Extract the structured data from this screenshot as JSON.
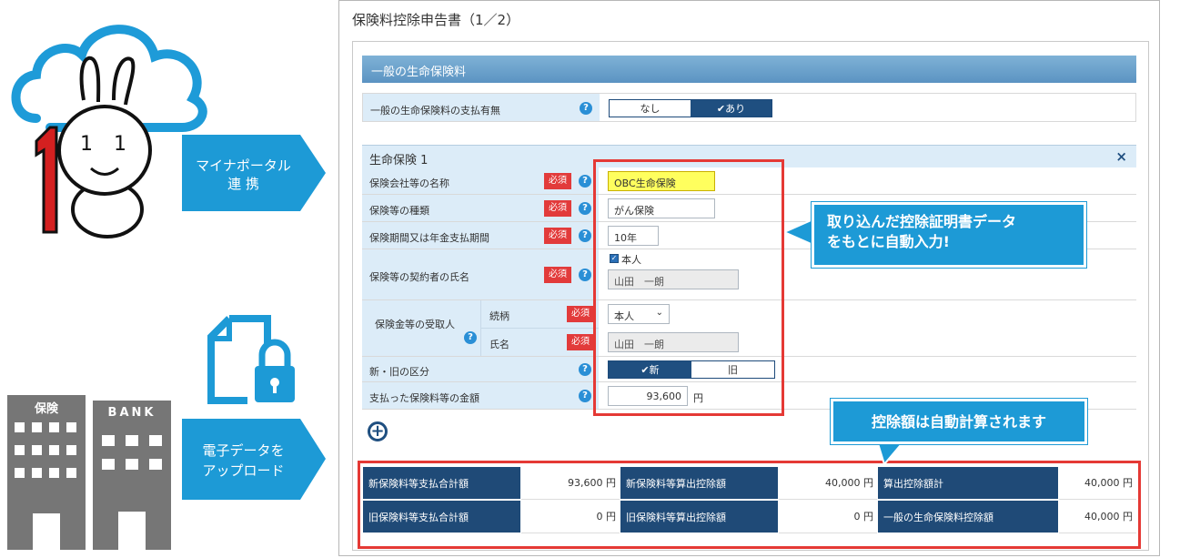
{
  "left": {
    "arrow_top": {
      "line1": "マイナポータル",
      "line2": "連 携"
    },
    "arrow_bottom": {
      "line1": "電子データを",
      "line2": "アップロード"
    },
    "building_insurance": "保険",
    "building_bank": "BANK"
  },
  "panel": {
    "title": "保険料控除申告書（1／2）",
    "section_title": "一般の生命保険料",
    "payment_label": "一般の生命保険料の支払有無",
    "payment_options": [
      "なし",
      "✔あり"
    ],
    "sub_title": "生命保険 1",
    "close_symbol": "×",
    "required_label": "必須",
    "fields": {
      "company_label": "保険会社等の名称",
      "company_value": "OBC生命保険",
      "type_label": "保険等の種類",
      "type_value": "がん保険",
      "period_label": "保険期間又は年金支払期間",
      "period_value": "10年",
      "contractor_label": "保険等の契約者の氏名",
      "contractor_checkbox": "本人",
      "contractor_value": "山田　一朗",
      "recipient_label": "保険金等の受取人",
      "relation_label": "続柄",
      "relation_value": "本人",
      "recipient_name_label": "氏名",
      "recipient_name_value": "山田　一朗",
      "new_old_label": "新・旧の区分",
      "new_old_options": [
        "✔新",
        "旧"
      ],
      "amount_label": "支払った保険料等の金額",
      "amount_value": "93,600",
      "amount_unit": "円"
    },
    "summary": [
      [
        {
          "label": "新保険料等支払合計額",
          "value": "93,600 円"
        },
        {
          "label": "新保険料等算出控除額",
          "value": "40,000 円"
        },
        {
          "label": "算出控除額計",
          "value": "40,000 円"
        }
      ],
      [
        {
          "label": "旧保険料等支払合計額",
          "value": "0 円"
        },
        {
          "label": "旧保険料等算出控除額",
          "value": "0 円"
        },
        {
          "label": "一般の生命保険料控除額",
          "value": "40,000 円"
        }
      ]
    ]
  },
  "callouts": {
    "auto_input_line1": "取り込んだ控除証明書データ",
    "auto_input_line2": "をもとに自動入力!",
    "auto_calc": "控除額は自動計算されます"
  },
  "colors": {
    "accent_blue": "#1d9ad6",
    "navy": "#1f4a77",
    "required_red": "#e23b3b",
    "highlight_red": "#e53935"
  }
}
